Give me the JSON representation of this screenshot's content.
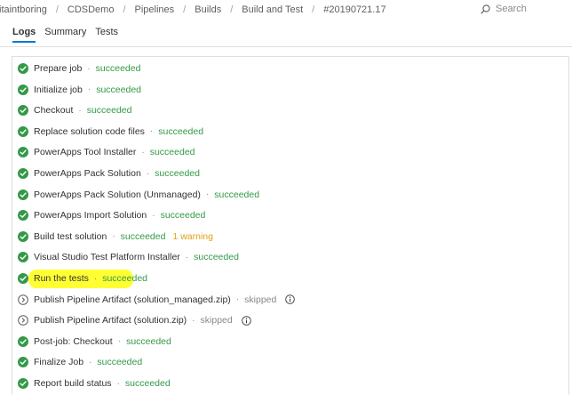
{
  "breadcrumb": [
    "itaintboring",
    "CDSDemo",
    "Pipelines",
    "Builds",
    "Build and Test",
    "#20190721.17"
  ],
  "search": {
    "placeholder": "Search",
    "icon": "search-icon"
  },
  "tabs": [
    {
      "label": "Logs",
      "active": true
    },
    {
      "label": "Summary",
      "active": false
    },
    {
      "label": "Tests",
      "active": false
    }
  ],
  "separator": "·",
  "steps": [
    {
      "name": "Prepare job",
      "status": "succeeded"
    },
    {
      "name": "Initialize job",
      "status": "succeeded"
    },
    {
      "name": "Checkout",
      "status": "succeeded"
    },
    {
      "name": "Replace solution code files",
      "status": "succeeded"
    },
    {
      "name": "PowerApps Tool Installer",
      "status": "succeeded"
    },
    {
      "name": "PowerApps Pack Solution",
      "status": "succeeded"
    },
    {
      "name": "PowerApps Pack Solution (Unmanaged)",
      "status": "succeeded"
    },
    {
      "name": "PowerApps Import Solution",
      "status": "succeeded"
    },
    {
      "name": "Build test solution",
      "status": "succeeded",
      "warning": "1 warning"
    },
    {
      "name": "Visual Studio Test Platform Installer",
      "status": "succeeded"
    },
    {
      "name": "Run the tests",
      "status": "succeeded",
      "highlighted": true
    },
    {
      "name": "Publish Pipeline Artifact (solution_managed.zip)",
      "status": "skipped",
      "info": true
    },
    {
      "name": "Publish Pipeline Artifact (solution.zip)",
      "status": "skipped",
      "info": true
    },
    {
      "name": "Post-job: Checkout",
      "status": "succeeded"
    },
    {
      "name": "Finalize Job",
      "status": "succeeded"
    },
    {
      "name": "Report build status",
      "status": "succeeded"
    }
  ],
  "colors": {
    "succeeded": "#339947",
    "skipped": "#8a8886",
    "warning": "#e0a113",
    "accent": "#0078d4",
    "highlight": "#ffff29"
  }
}
